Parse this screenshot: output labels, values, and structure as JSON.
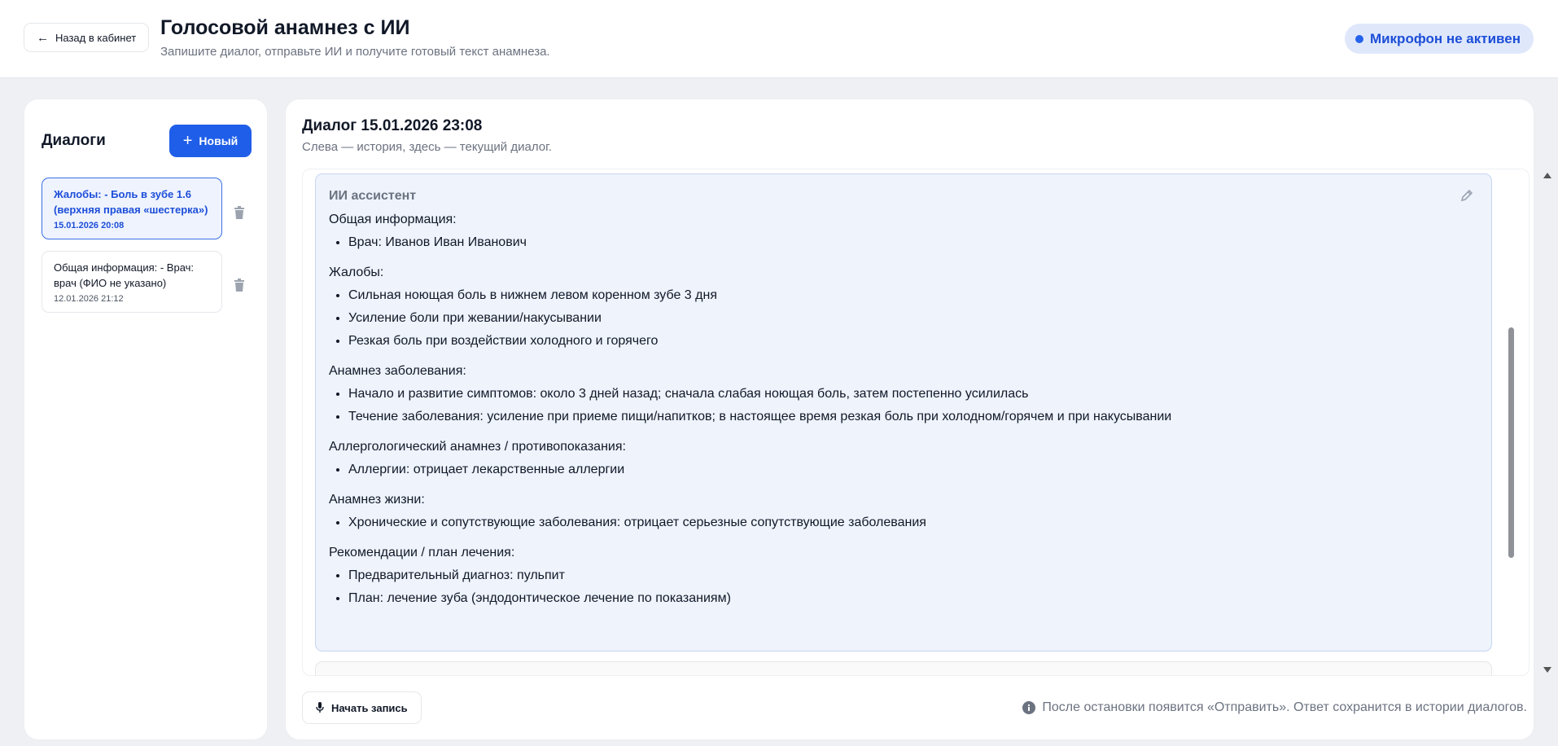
{
  "header": {
    "back_label": "Назад в кабинет",
    "title": "Голосовой анамнез с ИИ",
    "subtitle": "Запишите диалог, отправьте ИИ и получите готовый текст анамнеза.",
    "mic_status": "Микрофон не активен"
  },
  "sidebar": {
    "title": "Диалоги",
    "new_label": "Новый",
    "dialogs": [
      {
        "text": "Жалобы: - Боль в зубе 1.6 (верхняя правая «шестерка»)",
        "date": "15.01.2026 20:08",
        "active": true
      },
      {
        "text": "Общая информация: - Врач: врач (ФИО не указано)",
        "date": "12.01.2026 21:12",
        "active": false
      }
    ]
  },
  "main": {
    "title": "Диалог 15.01.2026 23:08",
    "subtitle": "Слева — история, здесь — текущий диалог.",
    "message": {
      "author": "ИИ ассистент",
      "sections": [
        {
          "title": "Общая информация:",
          "items": [
            "Врач: Иванов Иван Иванович"
          ]
        },
        {
          "title": "Жалобы:",
          "items": [
            "Сильная ноющая боль в нижнем левом коренном зубе 3 дня",
            "Усиление боли при жевании/накусывании",
            "Резкая боль при воздействии холодного и горячего"
          ]
        },
        {
          "title": "Анамнез заболевания:",
          "items": [
            "Начало и развитие симптомов: около 3 дней назад; сначала слабая ноющая боль, затем постепенно усилилась",
            "Течение заболевания: усиление при приеме пищи/напитков; в настоящее время резкая боль при холодном/горячем и при накусывании"
          ]
        },
        {
          "title": "Аллергологический анамнез / противопоказания:",
          "items": [
            "Аллергии: отрицает лекарственные аллергии"
          ]
        },
        {
          "title": "Анамнез жизни:",
          "items": [
            "Хронические и сопутствующие заболевания: отрицает серьезные сопутствующие заболевания"
          ]
        },
        {
          "title": "Рекомендации / план лечения:",
          "items": [
            "Предварительный диагноз: пульпит",
            "План: лечение зуба (эндодонтическое лечение по показаниям)"
          ]
        }
      ]
    },
    "record_label": "Начать запись",
    "hint": "После остановки появится «Отправить». Ответ сохранится в истории диалогов."
  },
  "colors": {
    "accent": "#1f5ee8",
    "active_text": "#1d4ed8",
    "message_bg": "#eef3fc",
    "mic_badge_bg": "#dfe8fb"
  },
  "icons": {
    "back": "arrow-left-icon",
    "plus": "plus-icon",
    "trash": "trash-icon",
    "edit": "pencil-icon",
    "mic": "microphone-icon",
    "info": "info-icon"
  }
}
